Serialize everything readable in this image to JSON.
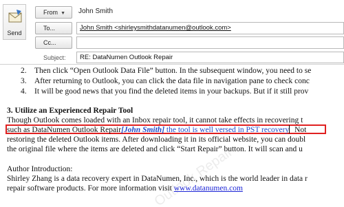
{
  "toolbar": {
    "send_label": "Send"
  },
  "header": {
    "from_button": "From",
    "from_value": "John Smith",
    "to_button": "To...",
    "to_value": "John Smith <shirleysmithdatanumen@outlook.com>",
    "cc_button": "Cc...",
    "cc_value": "",
    "subject_label": "Subject:",
    "subject_value": "RE: DataNumen Outlook Repair"
  },
  "body": {
    "list_items": [
      {
        "num": "2.",
        "text": "Then click “Open Outlook Data File” button. In the subsequent window, you need to se"
      },
      {
        "num": "3.",
        "text": "After returning to Outlook, you can click the data file in navigation pane to check conc"
      },
      {
        "num": "4.",
        "text": "It will be good news that you find the deleted items in your backups. But if it still prov"
      }
    ],
    "section_heading": "3. Utilize an Experienced Repair Tool",
    "para_line1": "Though Outlook comes loaded with an Inbox repair tool, it cannot take effects in recovering t",
    "para_line2_prefix": "such as DataNumen Outlook Repair",
    "para_line2_inserted_author": "[John Smith]",
    "para_line2_inserted_text": " the tool is well versed in PST recovery",
    "para_line2_suffix": " Not",
    "para_line3": "restoring the deleted Outlook items. After downloading it in its official website, you can doubl",
    "para_line4": "the original file where the items are deleted and click “Start Repair” button. It will scan and u",
    "author_heading": "Author Introduction:",
    "author_line1": "Shirley Zhang is a data recovery expert in DataNumen, Inc., which is the world leader in data r",
    "author_line2_prefix": "repair software products. For more information visit ",
    "author_link": "www.datanumen.com",
    "watermark": "Outlook Repair"
  },
  "colors": {
    "inserted_text": "#1f49c8",
    "highlight_box": "#e02020",
    "link": "#1b24d6"
  },
  "icons": [
    "send-envelope-icon",
    "from-dropdown-caret-icon"
  ]
}
